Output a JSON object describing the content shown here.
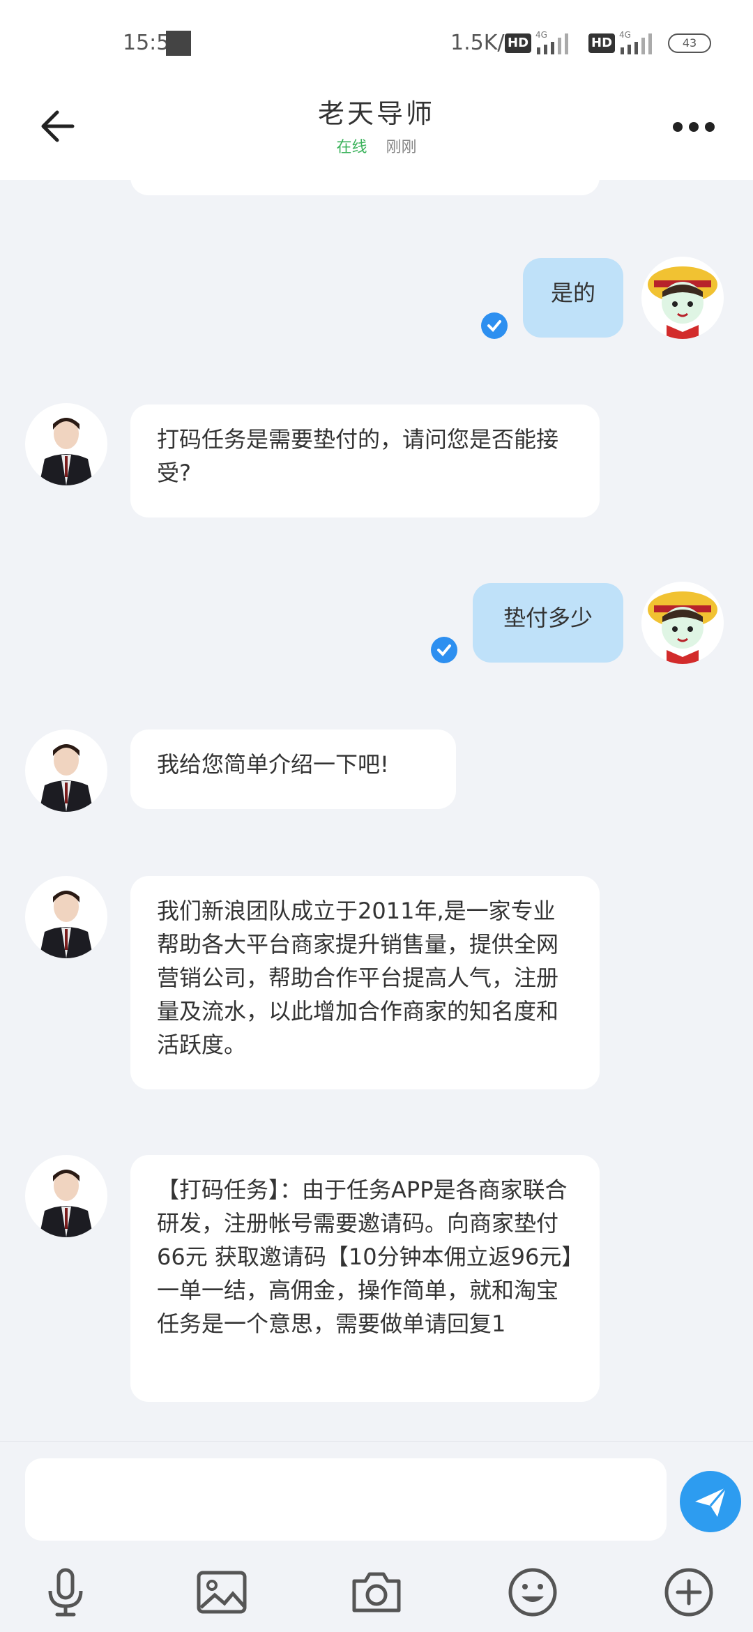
{
  "status_bar": {
    "time": "15:51",
    "net_speed": "1.5K/s",
    "hd_label": "HD",
    "network_type": "4G",
    "battery": "43"
  },
  "header": {
    "title": "老天导师",
    "status_online": "在线",
    "status_time": "刚刚"
  },
  "messages": [
    {
      "from": "me",
      "text": "是的"
    },
    {
      "from": "them",
      "text": "打码任务是需要垫付的，请问您是否能接受?"
    },
    {
      "from": "me",
      "text": "垫付多少"
    },
    {
      "from": "them",
      "text": "我给您简单介绍一下吧!"
    },
    {
      "from": "them",
      "text": "我们新浪团队成立于2011年,是一家专业帮助各大平台商家提升销售量，提供全网营销公司，帮助合作平台提高人气，注册量及流水，以此增加合作商家的知名度和活跃度。"
    },
    {
      "from": "them",
      "text": "【打码任务】：由于任务APP是各商家联合研发，注册帐号需要邀请码。向商家垫付66元 获取邀请码【10分钟本佣立返96元】一单一结，高佣金，操作简单，就和淘宝任务是一个意思，需要做单请回复1"
    }
  ],
  "input": {
    "placeholder": "",
    "value": ""
  },
  "toolbar": {
    "icons": [
      "microphone-icon",
      "image-icon",
      "camera-icon",
      "emoji-icon",
      "plus-icon"
    ]
  },
  "colors": {
    "outgoing_bubble": "#bfe1f9",
    "incoming_bubble": "#ffffff",
    "online_green": "#3cb35c",
    "accent_blue": "#2d9cf0"
  }
}
